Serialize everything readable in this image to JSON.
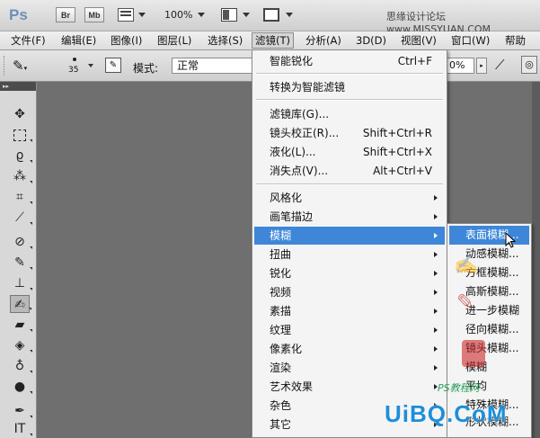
{
  "titlebar": {
    "app_logo": "Ps",
    "buttons": [
      "Br",
      "Mb"
    ],
    "zoom": "100%",
    "window_title": "思缘设计论坛 www.MISSYUAN.COM"
  },
  "menubar": {
    "items": [
      "文件(F)",
      "编辑(E)",
      "图像(I)",
      "图层(L)",
      "选择(S)",
      "滤镜(T)",
      "分析(A)",
      "3D(D)",
      "视图(V)",
      "窗口(W)",
      "帮助(H)"
    ],
    "active": "滤镜(T)"
  },
  "options": {
    "brush_size": "35",
    "mode_label": "模式:",
    "mode_value": "正常",
    "strength_value": "0%"
  },
  "filter_menu": {
    "items": [
      {
        "label": "智能锐化",
        "shortcut": "Ctrl+F",
        "submenu": false
      },
      {
        "label": "转换为智能滤镜",
        "shortcut": "",
        "submenu": false
      },
      {
        "label": "滤镜库(G)...",
        "shortcut": "",
        "submenu": false
      },
      {
        "label": "镜头校正(R)...",
        "shortcut": "Shift+Ctrl+R",
        "submenu": false
      },
      {
        "label": "液化(L)...",
        "shortcut": "Shift+Ctrl+X",
        "submenu": false
      },
      {
        "label": "消失点(V)...",
        "shortcut": "Alt+Ctrl+V",
        "submenu": false
      },
      {
        "label": "风格化",
        "shortcut": "",
        "submenu": true
      },
      {
        "label": "画笔描边",
        "shortcut": "",
        "submenu": true
      },
      {
        "label": "模糊",
        "shortcut": "",
        "submenu": true,
        "highlighted": true
      },
      {
        "label": "扭曲",
        "shortcut": "",
        "submenu": true
      },
      {
        "label": "锐化",
        "shortcut": "",
        "submenu": true
      },
      {
        "label": "视频",
        "shortcut": "",
        "submenu": true
      },
      {
        "label": "素描",
        "shortcut": "",
        "submenu": true
      },
      {
        "label": "纹理",
        "shortcut": "",
        "submenu": true
      },
      {
        "label": "像素化",
        "shortcut": "",
        "submenu": true
      },
      {
        "label": "渲染",
        "shortcut": "",
        "submenu": true
      },
      {
        "label": "艺术效果",
        "shortcut": "",
        "submenu": true
      },
      {
        "label": "杂色",
        "shortcut": "",
        "submenu": true
      },
      {
        "label": "其它",
        "shortcut": "",
        "submenu": true
      }
    ]
  },
  "blur_submenu": {
    "items": [
      "表面模糊...",
      "动感模糊...",
      "方框模糊...",
      "高斯模糊...",
      "进一步模糊",
      "径向模糊...",
      "镜头模糊...",
      "模糊",
      "平均",
      "特殊模糊...",
      "形状模糊..."
    ],
    "highlighted": "表面模糊..."
  },
  "watermarks": {
    "site": "UiBQ.CoM",
    "sub": "PS教程网"
  },
  "tools": [
    "move-icon",
    "marquee-icon",
    "lasso-icon",
    "quick-select-icon",
    "crop-icon",
    "eyedropper-icon",
    "healing-icon",
    "brush-icon",
    "stamp-icon",
    "history-brush-icon",
    "eraser-icon",
    "paint-bucket-icon",
    "blur-icon",
    "dodge-icon",
    "pen-icon",
    "type-icon"
  ],
  "colors": {
    "highlight": "#3e87d8",
    "canvas": "#6f6f6f"
  }
}
